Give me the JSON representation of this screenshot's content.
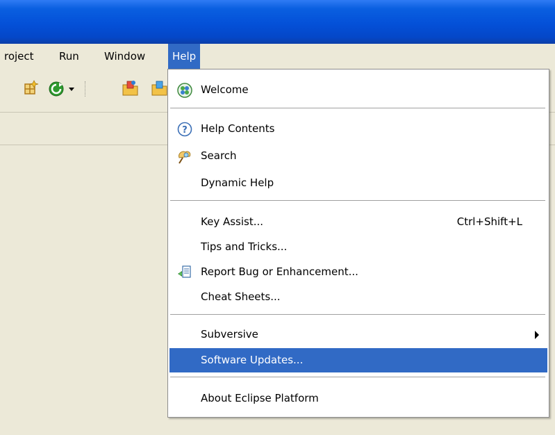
{
  "colors": {
    "titlebar": "#0450d8",
    "menu_highlight": "#316ac5",
    "chrome": "#ece9d8"
  },
  "menubar": {
    "items": [
      {
        "label": "roject"
      },
      {
        "label": "Run"
      },
      {
        "label": "Window"
      },
      {
        "label": "Help",
        "active": true
      }
    ]
  },
  "toolbar": {
    "icons": [
      "new-class-icon",
      "run-icon",
      "dropdown-arrow-icon",
      "open-folder-icon",
      "open-folder-icon"
    ]
  },
  "help_menu": {
    "items": [
      {
        "label": "Welcome",
        "icon": "welcome-icon"
      },
      {
        "label": "Help Contents",
        "icon": "help-icon"
      },
      {
        "label": "Search",
        "icon": "search-icon"
      },
      {
        "label": "Dynamic Help"
      },
      {
        "label": "Key Assist...",
        "shortcut": "Ctrl+Shift+L"
      },
      {
        "label": "Tips and Tricks..."
      },
      {
        "label": "Report Bug or Enhancement...",
        "icon": "report-bug-icon"
      },
      {
        "label": "Cheat Sheets..."
      },
      {
        "label": "Subversive",
        "submenu": true
      },
      {
        "label": "Software Updates...",
        "selected": true
      },
      {
        "label": "About Eclipse Platform"
      }
    ]
  }
}
